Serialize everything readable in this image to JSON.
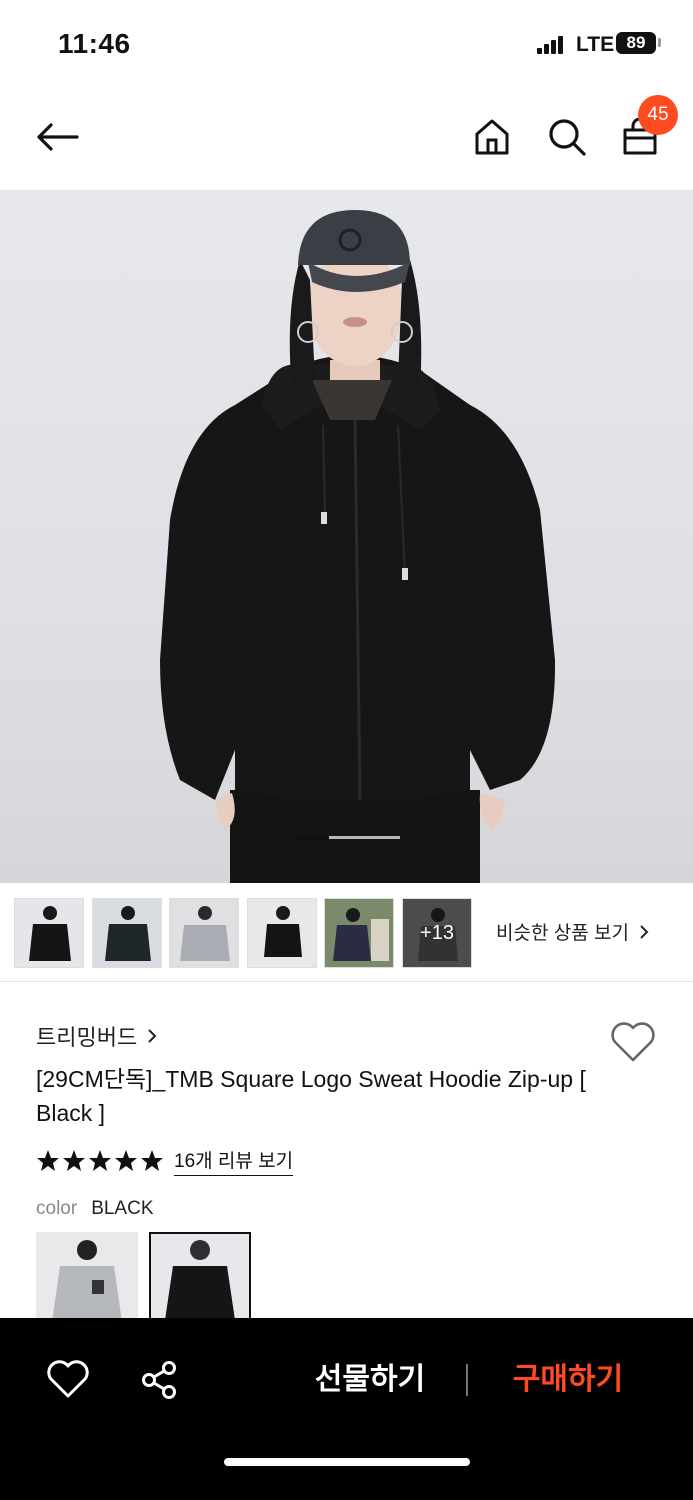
{
  "status_bar": {
    "time": "11:46",
    "network": "LTE",
    "battery": "89"
  },
  "nav": {
    "back_icon": "arrow-left-icon",
    "home_icon": "home-icon",
    "search_icon": "search-icon",
    "cart_icon": "shopping-bag-icon",
    "cart_badge": "45",
    "badge_color": "#ff4b1f"
  },
  "gallery": {
    "current_index": 1,
    "thumbnails": [
      {
        "label": ""
      },
      {
        "label": ""
      },
      {
        "label": ""
      },
      {
        "label": ""
      },
      {
        "label": ""
      },
      {
        "label": "+13"
      }
    ],
    "similar_link": "비슷한 상품 보기"
  },
  "product": {
    "brand": "트리밍버드",
    "title": "[29CM단독]_TMB Square Logo Sweat Hoodie Zip-up [ Black ]",
    "rating_stars": 5,
    "review_link": "16개 리뷰 보기",
    "color_label": "color",
    "color_value": "BLACK",
    "color_options": [
      "GRAY",
      "BLACK"
    ],
    "selected_color_index": 1
  },
  "bottom_bar": {
    "gift_label": "선물하기",
    "buy_label": "구매하기",
    "buy_color": "#ff4b1f",
    "background": "#000000"
  }
}
